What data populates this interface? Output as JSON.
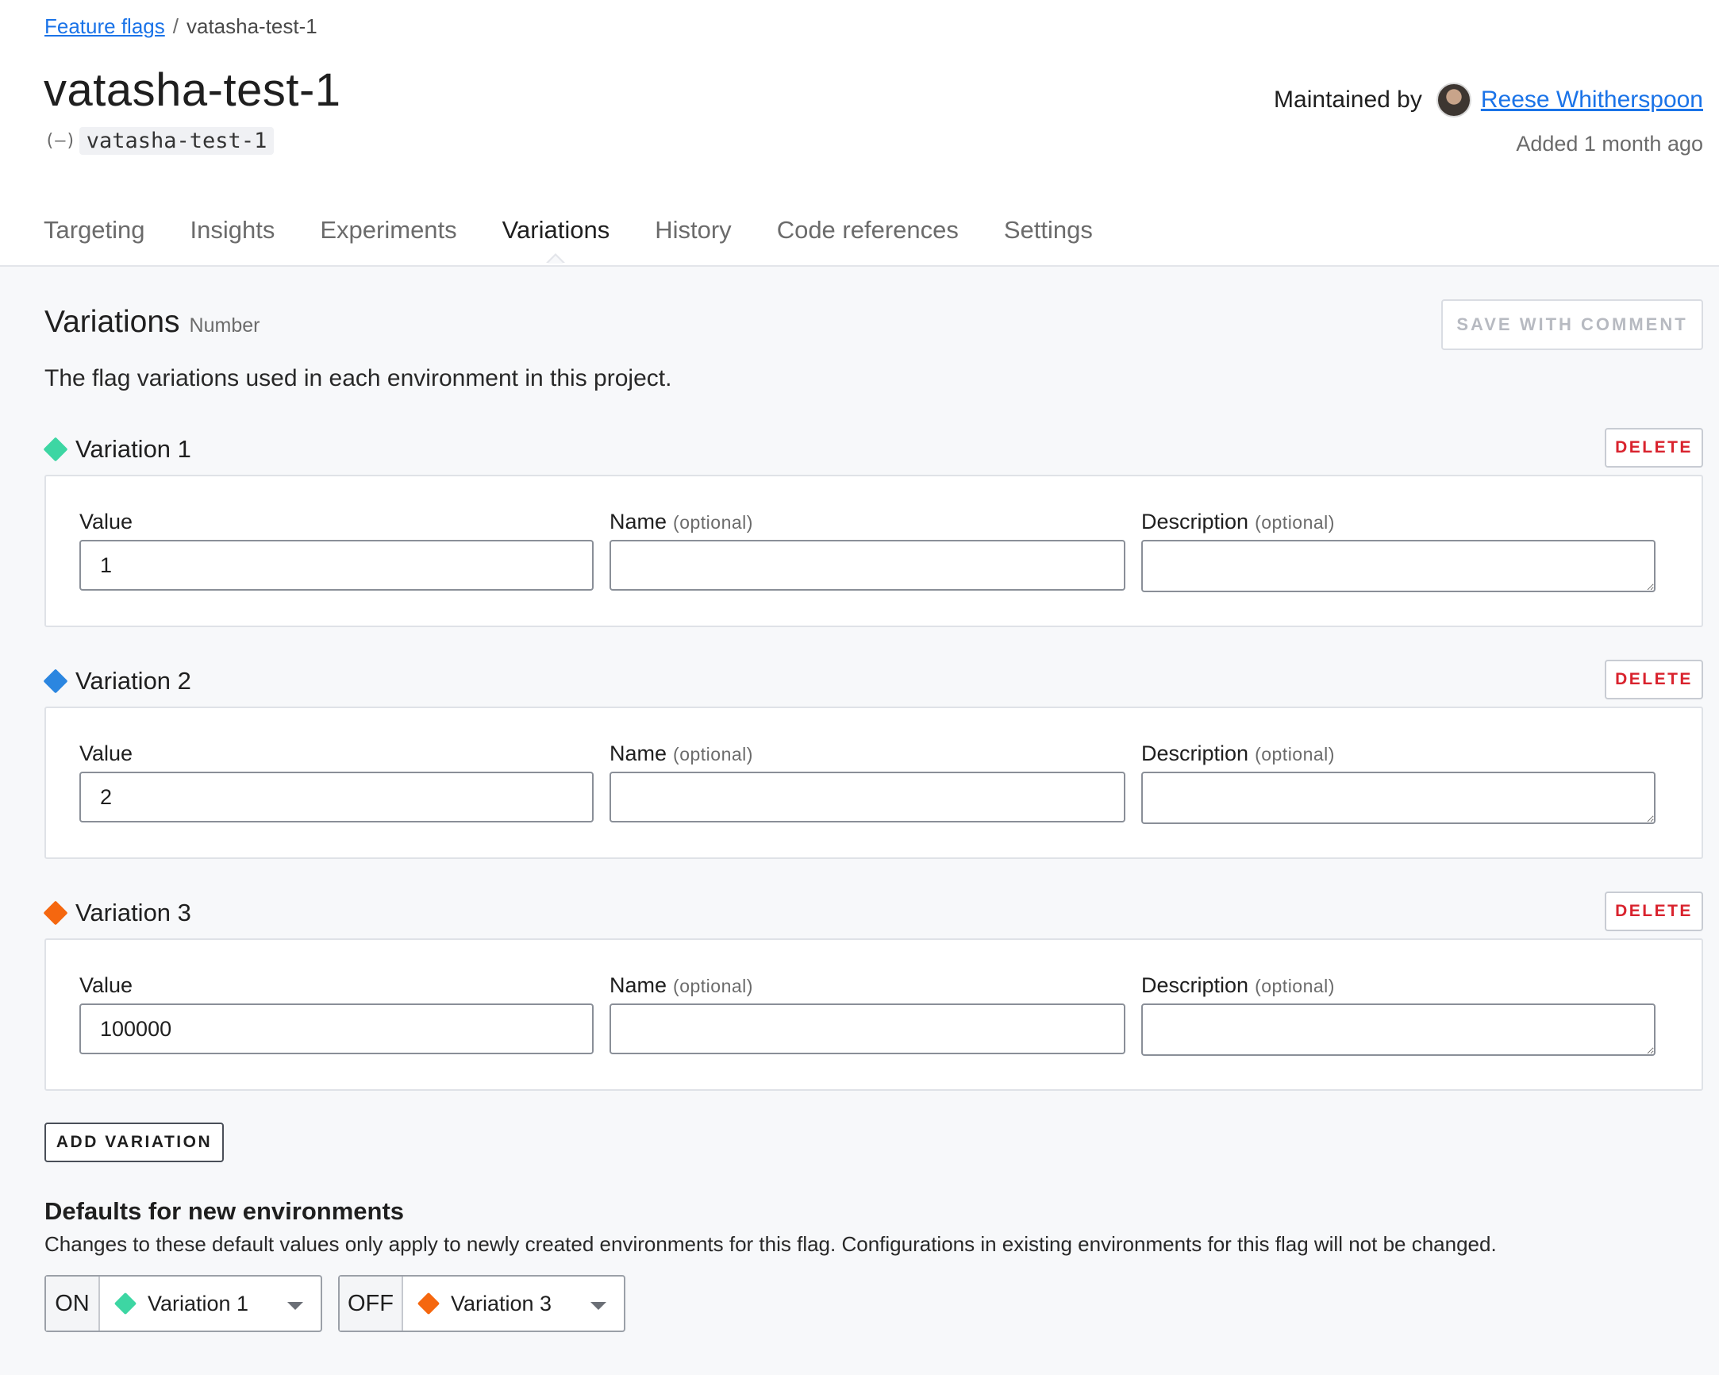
{
  "breadcrumb": {
    "parent": "Feature flags",
    "separator": "/",
    "current": "vatasha-test-1"
  },
  "flag": {
    "title": "vatasha-test-1",
    "key_icon": "(–)",
    "key": "vatasha-test-1"
  },
  "maintainer": {
    "label": "Maintained by",
    "name": "Reese Whitherspoon",
    "added": "Added 1 month ago"
  },
  "tabs": [
    {
      "label": "Targeting",
      "active": false
    },
    {
      "label": "Insights",
      "active": false
    },
    {
      "label": "Experiments",
      "active": false
    },
    {
      "label": "Variations",
      "active": true
    },
    {
      "label": "History",
      "active": false
    },
    {
      "label": "Code references",
      "active": false
    },
    {
      "label": "Settings",
      "active": false
    }
  ],
  "section": {
    "title": "Variations",
    "type": "Number",
    "save_label": "SAVE WITH COMMENT",
    "intro": "The flag variations used in each environment in this project."
  },
  "field_labels": {
    "value": "Value",
    "name": "Name",
    "description": "Description",
    "optional": "(optional)"
  },
  "variations": [
    {
      "label": "Variation 1",
      "color": "#3dd6a3",
      "value": "1",
      "name": "",
      "description": "",
      "delete_label": "DELETE"
    },
    {
      "label": "Variation 2",
      "color": "#2b86e0",
      "value": "2",
      "name": "",
      "description": "",
      "delete_label": "DELETE"
    },
    {
      "label": "Variation 3",
      "color": "#f5670f",
      "value": "100000",
      "name": "",
      "description": "",
      "delete_label": "DELETE"
    }
  ],
  "add_variation_label": "ADD VARIATION",
  "defaults": {
    "title": "Defaults for new environments",
    "description": "Changes to these default values only apply to newly created environments for this flag. Configurations in existing environments for this flag will not be changed.",
    "on": {
      "state": "ON",
      "selected": "Variation 1",
      "color": "#3dd6a3"
    },
    "off": {
      "state": "OFF",
      "selected": "Variation 3",
      "color": "#f5670f"
    }
  },
  "colors": {
    "link": "#1a73e8",
    "danger": "#d9232e"
  }
}
